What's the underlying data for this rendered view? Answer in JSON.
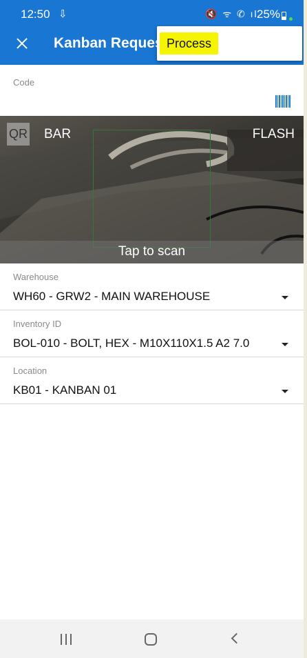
{
  "status_bar": {
    "time": "12:50",
    "download_icon": "⇩",
    "icons": "🔇 ᯤ ✆ ıl",
    "battery": "25%"
  },
  "app_bar": {
    "title": "Kanban Request",
    "close_icon": "close-icon"
  },
  "menu": {
    "process_label": "Process",
    "highlight_color": "#f5f500"
  },
  "code_field": {
    "label": "Code",
    "scan_icon": "barcode-icon"
  },
  "scanner": {
    "qr_label": "QR",
    "bar_label": "BAR",
    "flash_label": "FLASH",
    "tap_label": "Tap to scan"
  },
  "fields": [
    {
      "label": "Warehouse",
      "value": "WH60 - GRW2 - MAIN WAREHOUSE"
    },
    {
      "label": "Inventory ID",
      "value": "BOL-010 - BOLT, HEX - M10X110X1.5 A2 7.0"
    },
    {
      "label": "Location",
      "value": "KB01 - KANBAN 01"
    }
  ],
  "colors": {
    "primary": "#1976d2",
    "scan_box": "#2f7a34"
  }
}
